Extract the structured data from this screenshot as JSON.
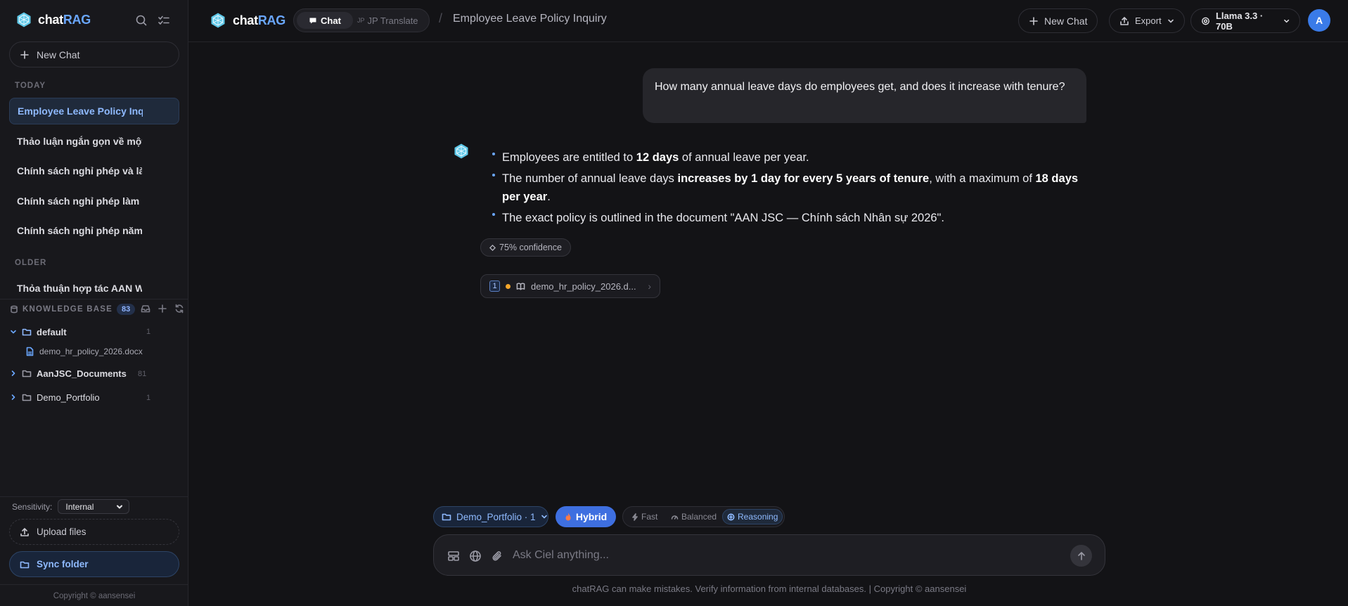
{
  "brand": {
    "name_prefix": "chat",
    "name_suffix": "RAG",
    "accent": "#6aa7ff"
  },
  "sidebar": {
    "new_chat_label": "New Chat",
    "today_label": "TODAY",
    "older_label": "OLDER",
    "chats_today": [
      {
        "title": "Employee Leave Policy Inquiry",
        "active": true
      },
      {
        "title": "Thảo luận ngắn gọn về một",
        "active": false
      },
      {
        "title": "Chính sách nghỉ phép và làm",
        "active": false
      },
      {
        "title": "Chính sách nghỉ phép làm v",
        "active": false
      },
      {
        "title": "Chính sách nghỉ phép năm",
        "active": false
      }
    ],
    "chats_older": [
      {
        "title": "Thỏa thuận hợp tác AAN W",
        "active": false
      }
    ],
    "knowledge_base": {
      "title": "KNOWLEDGE BASE",
      "count": "83",
      "folders": [
        {
          "name": "default",
          "count": "1",
          "expanded": true,
          "files": [
            "demo_hr_policy_2026.docx"
          ]
        },
        {
          "name": "AanJSC_Documents",
          "count": "81",
          "expanded": false,
          "files": []
        },
        {
          "name": "Demo_Portfolio",
          "count": "1",
          "expanded": false,
          "files": []
        }
      ]
    },
    "sensitivity_label": "Sensitivity:",
    "sensitivity_value": "Internal",
    "upload_label": "Upload files",
    "sync_label": "Sync folder",
    "copyright": "Copyright © aansensei"
  },
  "topbar": {
    "mode_chat": "Chat",
    "mode_translate_prefix": "JP",
    "mode_translate": "JP Translate",
    "breadcrumb_sep": "/",
    "title": "Employee Leave Policy Inquiry",
    "new_chat": "New Chat",
    "export": "Export",
    "model": "Llama 3.3 · 70B",
    "avatar_initial": "A"
  },
  "conversation": {
    "user_message": "How many annual leave days do employees get, and does it increase with tenure?",
    "answer_points": [
      {
        "pre": "Employees are entitled to ",
        "bold": "12 days",
        "post": " of annual leave per year."
      },
      {
        "pre": "The number of annual leave days ",
        "bold": "increases by 1 day for every 5 years of tenure",
        "mid": ", with a maximum of ",
        "bold2": "18 days per year",
        "post": "."
      },
      {
        "pre": "The exact policy is outlined in the document \"AAN JSC — Chính sách Nhân sự 2026\".",
        "bold": "",
        "post": ""
      }
    ],
    "confidence": "75% confidence",
    "source": {
      "index": "1",
      "name": "demo_hr_policy_2026.d..."
    }
  },
  "composer": {
    "folder": "Demo_Portfolio · 1",
    "search_mode": "Hybrid",
    "speed_options": [
      "Fast",
      "Balanced",
      "Reasoning"
    ],
    "speed_selected": "Reasoning",
    "placeholder": "Ask Ciel anything...",
    "footer": "chatRAG can make mistakes. Verify information from internal databases. | Copyright © aansensei"
  }
}
